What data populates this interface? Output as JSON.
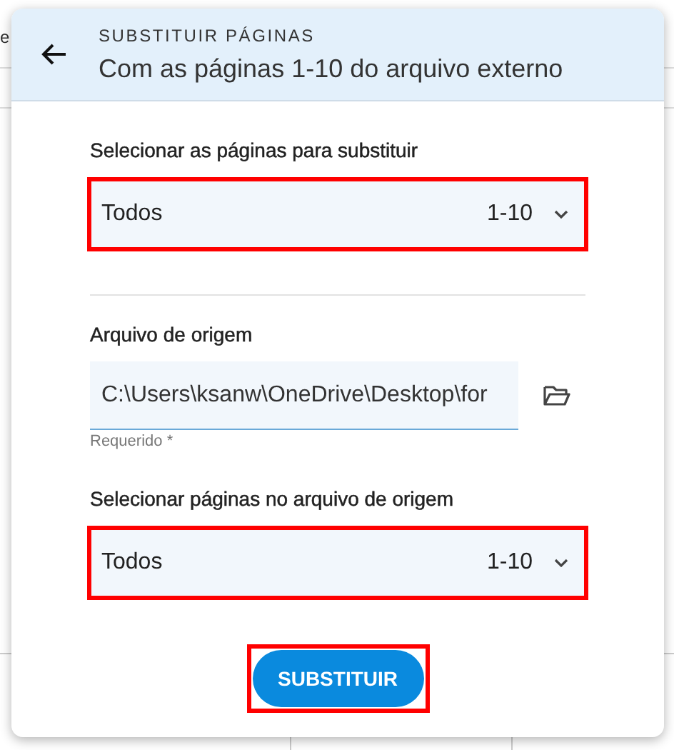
{
  "background": {
    "texts": [
      "e"
    ]
  },
  "dialog": {
    "eyebrow": "SUBSTITUIR PÁGINAS",
    "title": "Com as páginas 1-10 do arquivo externo",
    "sections": [
      {
        "kind": "select",
        "label": "Selecionar as páginas para substituir",
        "value": "Todos",
        "range": "1-10",
        "highlighted": true
      },
      {
        "kind": "divider"
      },
      {
        "kind": "file",
        "label": "Arquivo de origem",
        "value": "C:\\Users\\ksanw\\OneDrive\\Desktop\\for",
        "helper": "Requerido *"
      },
      {
        "kind": "select",
        "label": "Selecionar páginas no arquivo de origem",
        "value": "Todos",
        "range": "1-10",
        "highlighted": true
      }
    ],
    "button": {
      "label": "SUBSTITUIR",
      "highlighted": true
    }
  }
}
